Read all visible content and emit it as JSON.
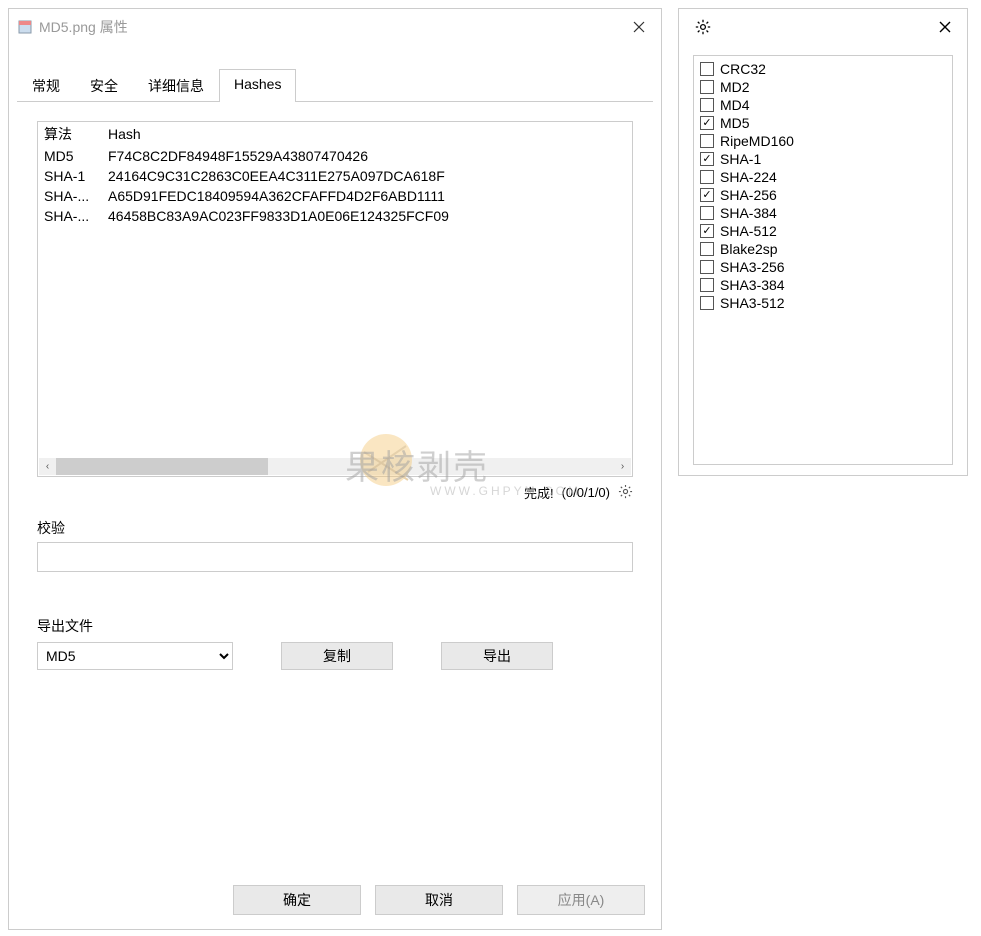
{
  "main": {
    "title": "MD5.png 属性",
    "tabs": [
      "常规",
      "安全",
      "详细信息",
      "Hashes"
    ],
    "activeTab": 3,
    "headers": {
      "algo": "算法",
      "hash": "Hash"
    },
    "rows": [
      {
        "algo": "MD5",
        "hash": "F74C8C2DF84948F15529A43807470426"
      },
      {
        "algo": "SHA-1",
        "hash": "24164C9C31C2863C0EEA4C311E275A097DCA618F"
      },
      {
        "algo": "SHA-...",
        "hash": "A65D91FEDC18409594A362CFAFFD4D2F6ABD1111"
      },
      {
        "algo": "SHA-...",
        "hash": "46458BC83A9AC023FF9833D1A0E06E124325FCF09"
      }
    ],
    "status_done": "完成!",
    "status_count": "(0/0/1/0)",
    "verify_label": "校验",
    "verify_value": "",
    "export_label": "导出文件",
    "export_selected": "MD5",
    "copy_label": "复制",
    "export_btn": "导出",
    "ok": "确定",
    "cancel": "取消",
    "apply": "应用(A)"
  },
  "settings": {
    "algorithms": [
      {
        "name": "CRC32",
        "checked": false
      },
      {
        "name": "MD2",
        "checked": false
      },
      {
        "name": "MD4",
        "checked": false
      },
      {
        "name": "MD5",
        "checked": true
      },
      {
        "name": "RipeMD160",
        "checked": false
      },
      {
        "name": "SHA-1",
        "checked": true
      },
      {
        "name": "SHA-224",
        "checked": false
      },
      {
        "name": "SHA-256",
        "checked": true
      },
      {
        "name": "SHA-384",
        "checked": false
      },
      {
        "name": "SHA-512",
        "checked": true
      },
      {
        "name": "Blake2sp",
        "checked": false
      },
      {
        "name": "SHA3-256",
        "checked": false
      },
      {
        "name": "SHA3-384",
        "checked": false
      },
      {
        "name": "SHA3-512",
        "checked": false
      }
    ]
  },
  "watermark": {
    "brand": "果核剥壳",
    "url": "WWW.GHPYM.COM"
  }
}
